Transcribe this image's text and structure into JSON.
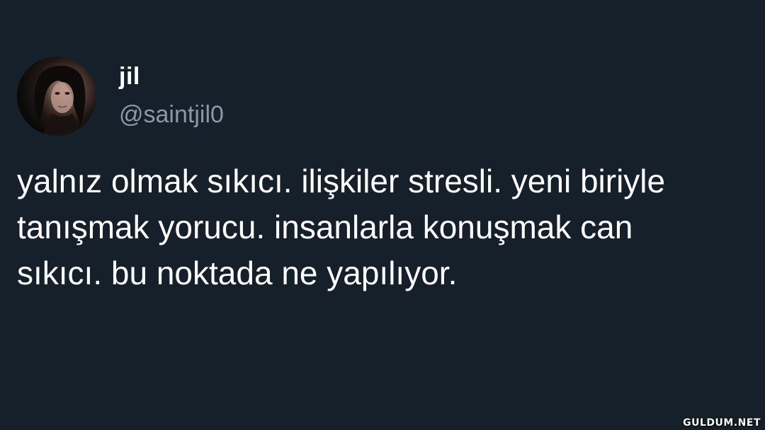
{
  "tweet": {
    "display_name": "jil",
    "handle": "@saintjil0",
    "text": "yalnız olmak sıkıcı. ilişkiler stresli. yeni biriyle tanışmak yorucu. insanlarla konuşmak can sıkıcı. bu noktada ne yapılıyor."
  },
  "watermark": "GULDUM.NET",
  "colors": {
    "background": "#15202b",
    "text": "#ffffff",
    "handle": "#8b98a5"
  }
}
